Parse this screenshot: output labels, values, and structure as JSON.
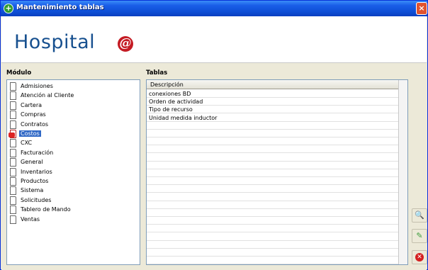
{
  "window": {
    "title": "Mantenimiento tablas",
    "close_glyph": "×"
  },
  "brand": {
    "name": "Hospital",
    "mark": "@"
  },
  "modules": {
    "label": "Módulo",
    "items": [
      {
        "label": "Admisiones",
        "selected": false
      },
      {
        "label": "Atención al Cliente",
        "selected": false
      },
      {
        "label": "Cartera",
        "selected": false
      },
      {
        "label": "Compras",
        "selected": false
      },
      {
        "label": "Contratos",
        "selected": false
      },
      {
        "label": "Costos",
        "selected": true
      },
      {
        "label": "CXC",
        "selected": false
      },
      {
        "label": "Facturación",
        "selected": false
      },
      {
        "label": "General",
        "selected": false
      },
      {
        "label": "Inventarios",
        "selected": false
      },
      {
        "label": "Productos",
        "selected": false
      },
      {
        "label": "Sistema",
        "selected": false
      },
      {
        "label": "Solicitudes",
        "selected": false
      },
      {
        "label": "Tablero de Mando",
        "selected": false
      },
      {
        "label": "Ventas",
        "selected": false
      }
    ]
  },
  "tables": {
    "label": "Tablas",
    "column_header": "Descripción",
    "rows": [
      "conexiones BD",
      "Orden de actividad",
      "Tipo de recurso",
      "Unidad  medida inductor"
    ]
  },
  "actions": {
    "search_icon": "search-icon",
    "edit_icon": "edit-icon",
    "delete_icon": "delete-icon",
    "delete_glyph": "✕"
  },
  "colors": {
    "title_bar": "#0e4fd6",
    "brand_text": "#17508f",
    "brand_mark": "#c41b23",
    "selection": "#3169c6"
  }
}
